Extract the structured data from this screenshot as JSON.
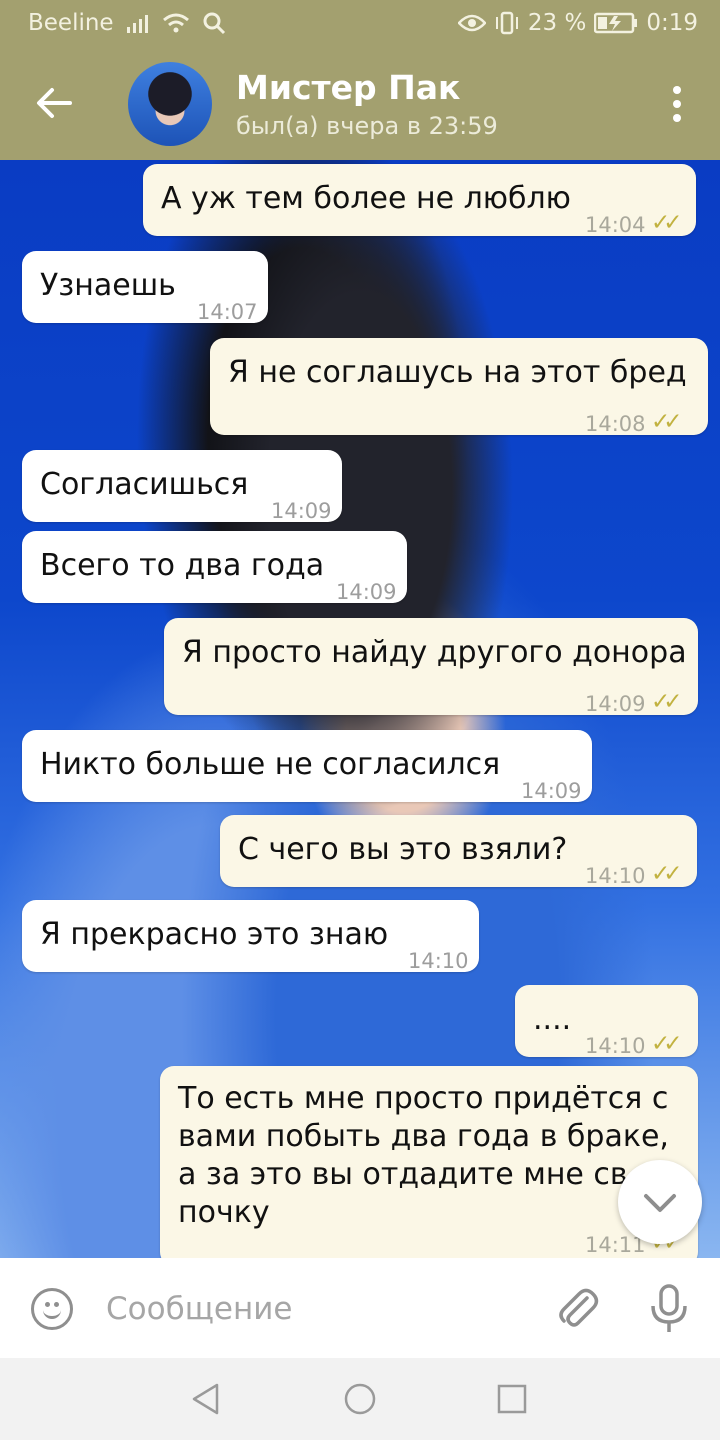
{
  "status_bar": {
    "carrier": "Beeline",
    "battery": "23 %",
    "time": "0:19"
  },
  "header": {
    "title": "Мистер Пак",
    "subtitle": "был(а) вчера в 23:59"
  },
  "messages": [
    {
      "text": "А уж тем более не люблю",
      "time": "14:04",
      "ticks": "✓✓"
    },
    {
      "text": "Узнаешь",
      "time": "14:07"
    },
    {
      "text": "Я не соглашусь на этот бред",
      "time": "14:08",
      "ticks": "✓✓"
    },
    {
      "text": "Согласишься",
      "time": "14:09"
    },
    {
      "text": "Всего то два года",
      "time": "14:09"
    },
    {
      "text": "Я просто найду другого донора",
      "time": "14:09",
      "ticks": "✓✓"
    },
    {
      "text": "Никто больше не согласился",
      "time": "14:09"
    },
    {
      "text": "С чего вы это взяли?",
      "time": "14:10",
      "ticks": "✓✓"
    },
    {
      "text": "Я прекрасно это знаю",
      "time": "14:10"
    },
    {
      "text": "....",
      "time": "14:10",
      "ticks": "✓✓"
    },
    {
      "text": "То есть мне просто придётся с",
      "time": "14:11",
      "ticks": "✓✓"
    },
    {
      "text": "вами побыть два года в браке,"
    },
    {
      "text": "а за это вы отдадите мне св"
    },
    {
      "text": "почку"
    }
  ],
  "composer": {
    "placeholder": "Сообщение"
  }
}
